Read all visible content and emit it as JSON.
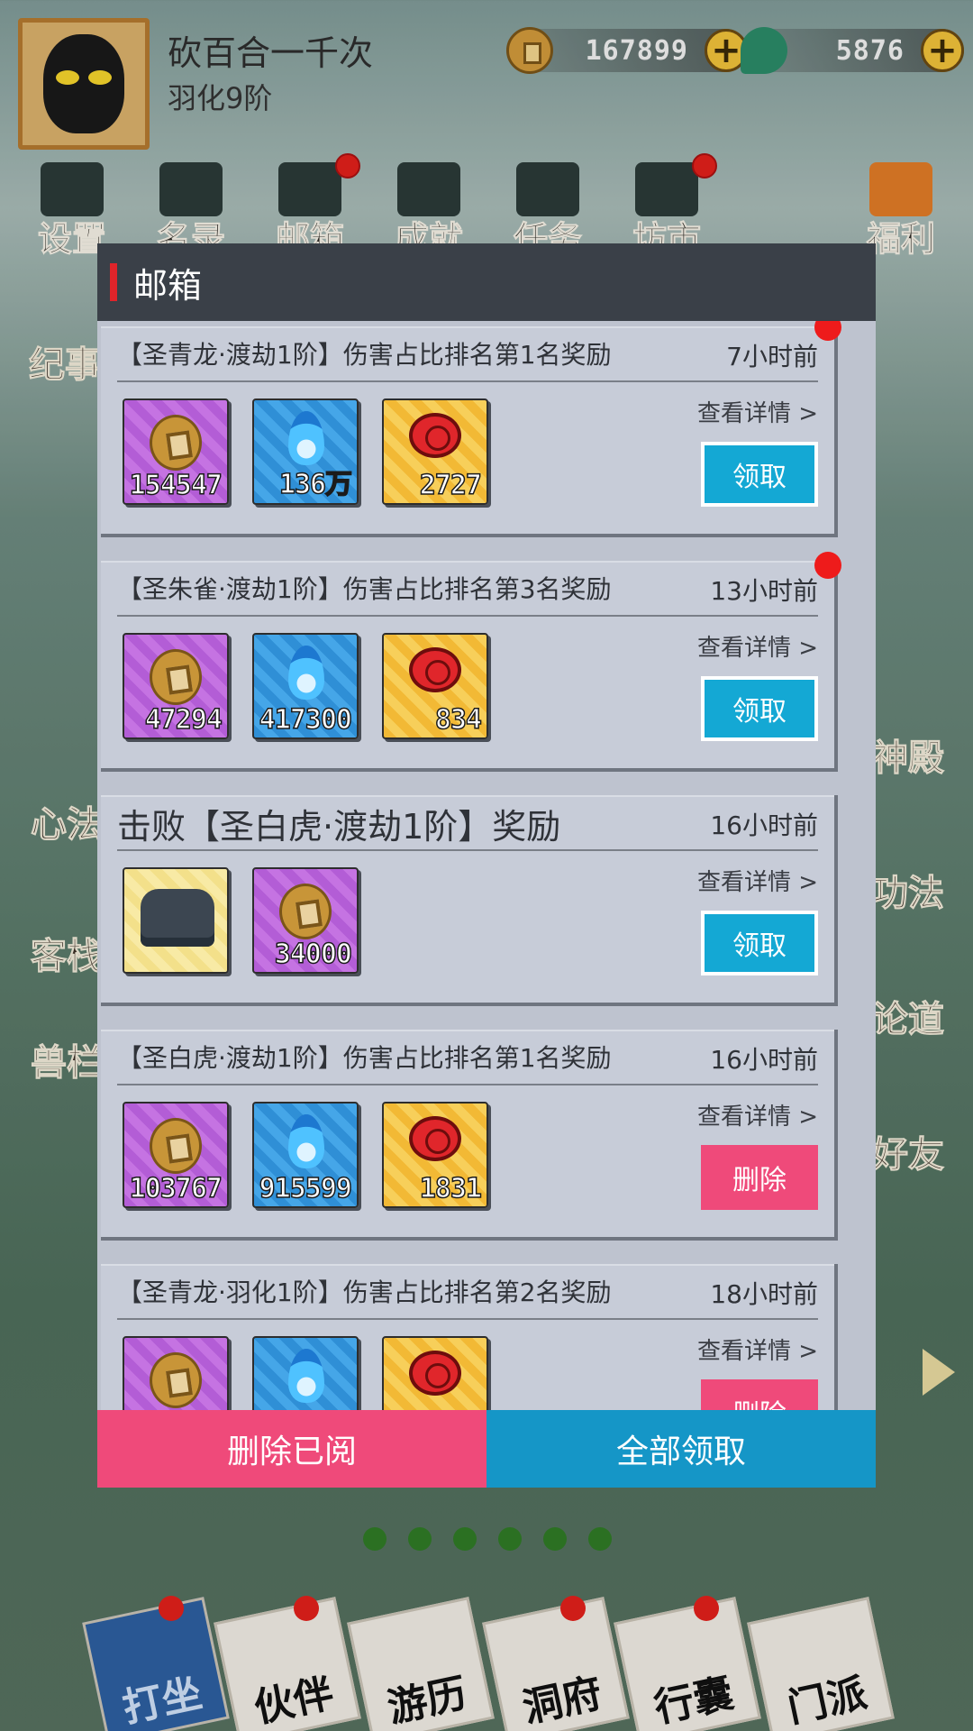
{
  "player": {
    "name": "砍百合一千次",
    "rank": "羽化9阶",
    "coins": "167899",
    "jade": "5876"
  },
  "top_menu": [
    {
      "label": "设置",
      "icon": "gear-icon",
      "has_dot": false
    },
    {
      "label": "名录",
      "icon": "ranking-icon",
      "has_dot": false
    },
    {
      "label": "邮箱",
      "icon": "envelope-icon",
      "has_dot": true
    },
    {
      "label": "成就",
      "icon": "trophy-icon",
      "has_dot": false
    },
    {
      "label": "任务",
      "icon": "clipboard-icon",
      "has_dot": false
    },
    {
      "label": "坊市",
      "icon": "shop-icon",
      "has_dot": true
    }
  ],
  "welfare_label": "福利",
  "side_left": [
    "纪事",
    "心法",
    "客栈",
    "兽栏"
  ],
  "side_right": [
    "神殿",
    "功法",
    "论道",
    "好友"
  ],
  "bottom_nav": [
    {
      "label": "打坐",
      "active": true,
      "has_dot": true
    },
    {
      "label": "伙伴",
      "active": false,
      "has_dot": true
    },
    {
      "label": "游历",
      "active": false,
      "has_dot": false
    },
    {
      "label": "洞府",
      "active": false,
      "has_dot": true
    },
    {
      "label": "行囊",
      "active": false,
      "has_dot": true
    },
    {
      "label": "门派",
      "active": false,
      "has_dot": false
    }
  ],
  "mailbox": {
    "title": "邮箱",
    "detail_label": "查看详情 >",
    "claim_label": "领取",
    "delete_label": "删除",
    "mails": [
      {
        "title": "【圣青龙·渡劫1阶】伤害占比排名第1名奖励",
        "time": "7小时前",
        "unread": true,
        "rewards": [
          {
            "type": "coin",
            "qty": "154547"
          },
          {
            "type": "spirit-flame",
            "qty": "136万"
          },
          {
            "type": "token",
            "qty": "2727"
          }
        ],
        "action": "claim"
      },
      {
        "title": "【圣朱雀·渡劫1阶】伤害占比排名第3名奖励",
        "time": "13小时前",
        "unread": true,
        "rewards": [
          {
            "type": "coin",
            "qty": "47294"
          },
          {
            "type": "spirit-flame",
            "qty": "417300"
          },
          {
            "type": "token",
            "qty": "834"
          }
        ],
        "action": "claim"
      },
      {
        "title": "击败【圣白虎·渡劫1阶】奖励",
        "time": "16小时前",
        "unread": false,
        "rewards": [
          {
            "type": "boots",
            "qty": ""
          },
          {
            "type": "coin",
            "qty": "34000"
          }
        ],
        "action": "claim"
      },
      {
        "title": "【圣白虎·渡劫1阶】伤害占比排名第1名奖励",
        "time": "16小时前",
        "unread": false,
        "rewards": [
          {
            "type": "coin",
            "qty": "103767"
          },
          {
            "type": "spirit-flame",
            "qty": "915599"
          },
          {
            "type": "token",
            "qty": "1831"
          }
        ],
        "action": "delete"
      },
      {
        "title": "【圣青龙·羽化1阶】伤害占比排名第2名奖励",
        "time": "18小时前",
        "unread": false,
        "rewards": [
          {
            "type": "coin",
            "qty": ""
          },
          {
            "type": "spirit-flame",
            "qty": ""
          },
          {
            "type": "token",
            "qty": ""
          }
        ],
        "action": "delete"
      }
    ],
    "footer": {
      "delete_read_label": "删除已阅",
      "claim_all_label": "全部领取"
    }
  },
  "pager": {
    "count": 6
  },
  "colors": {
    "claim_button": "#14a8d4",
    "delete_button": "#ef4a7a",
    "header_bg": "#3a4048",
    "accent_red": "#e0242a"
  }
}
